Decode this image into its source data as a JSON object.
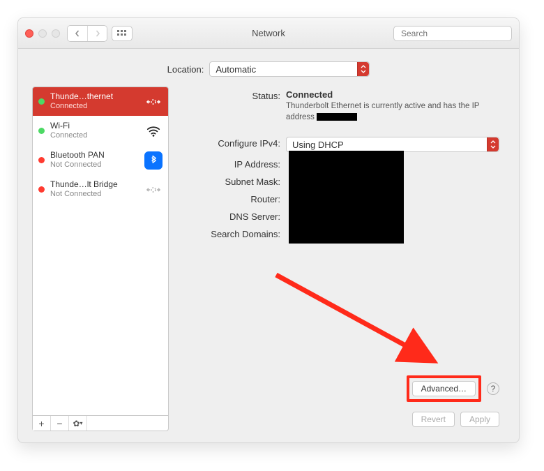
{
  "window": {
    "title": "Network"
  },
  "search": {
    "placeholder": "Search"
  },
  "location": {
    "label": "Location:",
    "value": "Automatic"
  },
  "sidebar": {
    "items": [
      {
        "name": "Thunde…thernet",
        "status": "Connected"
      },
      {
        "name": "Wi-Fi",
        "status": "Connected"
      },
      {
        "name": "Bluetooth PAN",
        "status": "Not Connected"
      },
      {
        "name": "Thunde…lt Bridge",
        "status": "Not Connected"
      }
    ]
  },
  "main": {
    "status_label": "Status:",
    "status_value": "Connected",
    "status_sub_prefix": "Thunderbolt Ethernet is currently active and has the IP address ",
    "configure_label": "Configure IPv4:",
    "configure_value": "Using DHCP",
    "ip_label": "IP Address:",
    "subnet_label": "Subnet Mask:",
    "router_label": "Router:",
    "dns_label": "DNS Server:",
    "search_domains_label": "Search Domains:",
    "advanced": "Advanced…",
    "help": "?",
    "revert": "Revert",
    "apply": "Apply"
  }
}
